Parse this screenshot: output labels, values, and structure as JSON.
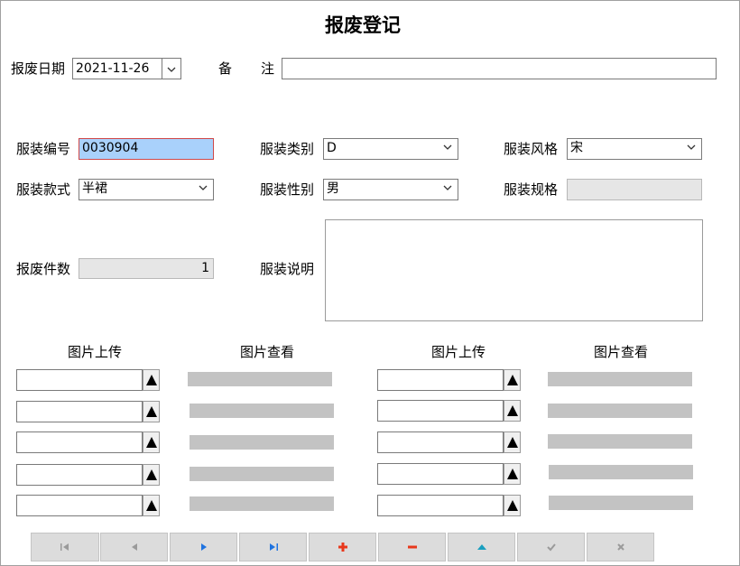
{
  "title": "报废登记",
  "scrap_date": {
    "label": "报废日期",
    "value": "2021-11-26"
  },
  "remark": {
    "label_a": "备",
    "label_b": "注",
    "value": ""
  },
  "garment_code": {
    "label": "服装编号",
    "value": "0030904"
  },
  "garment_category": {
    "label": "服装类别",
    "value": "D"
  },
  "garment_style": {
    "label": "服装风格",
    "value": "宋"
  },
  "garment_model": {
    "label": "服装款式",
    "value": "半裙"
  },
  "garment_gender": {
    "label": "服装性别",
    "value": "男"
  },
  "garment_spec": {
    "label": "服装规格",
    "value": ""
  },
  "scrap_count": {
    "label": "报废件数",
    "value": "1"
  },
  "garment_desc": {
    "label": "服装说明",
    "value": ""
  },
  "image_columns": {
    "upload": "图片上传",
    "view": "图片查看"
  },
  "colors": {
    "accent_blue": "#1f73e0",
    "accent_red": "#e8381c",
    "accent_teal": "#1a9fbf",
    "selected_bg": "#a9d1fb"
  },
  "nav_buttons": [
    "first",
    "prev",
    "next",
    "last",
    "add",
    "delete",
    "edit",
    "save",
    "cancel"
  ]
}
